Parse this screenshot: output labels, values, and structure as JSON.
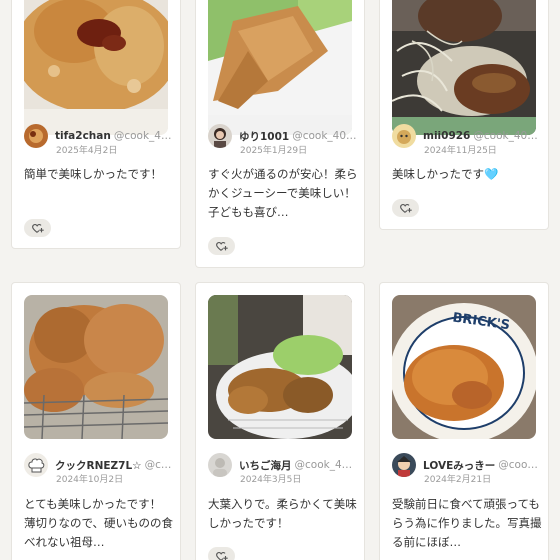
{
  "posts": [
    {
      "user_name": "tifa2chan",
      "user_id": "@cook_4…",
      "date": "2025年4月2日",
      "comment": "簡単で美味しかったです！",
      "avatar_icon": "food-photo-avatar",
      "like_icon": "heart-plus-icon"
    },
    {
      "user_name": "ゆり1001",
      "user_id": "@cook_40…",
      "date": "2025年1月29日",
      "comment": "すぐ火が通るのが安心！柔らかくジューシーで美味しい！子どもも喜び…",
      "avatar_icon": "person-photo-avatar",
      "like_icon": "heart-plus-icon"
    },
    {
      "user_name": "mii0926",
      "user_id": "@cook_404…",
      "date": "2024年11月25日",
      "comment": "美味しかったです🩵",
      "avatar_icon": "dog-photo-avatar",
      "like_icon": "heart-plus-icon"
    },
    {
      "user_name": "クックRNEZ7L☆",
      "user_id": "@c…",
      "date": "2024年10月2日",
      "comment": "とても美味しかったです！ 薄切りなので、硬いものの食べれない祖母…",
      "avatar_icon": "chef-hat-avatar",
      "like_icon": "heart-plus-icon"
    },
    {
      "user_name": "いちご海月",
      "user_id": "@cook_4…",
      "date": "2024年3月5日",
      "comment": "大葉入りで。柔らかくて美味しかったです！",
      "avatar_icon": "person-photo-avatar",
      "like_icon": "heart-plus-icon"
    },
    {
      "user_name": "LOVEみっきー",
      "user_id": "@coo…",
      "date": "2024年2月21日",
      "comment": "受験前日に食べて頑張ってもらう為に作りました。写真撮る前にほぼ…",
      "avatar_icon": "character-photo-avatar",
      "like_icon": "heart-plus-icon"
    }
  ],
  "plate_text": "BRICK'S"
}
